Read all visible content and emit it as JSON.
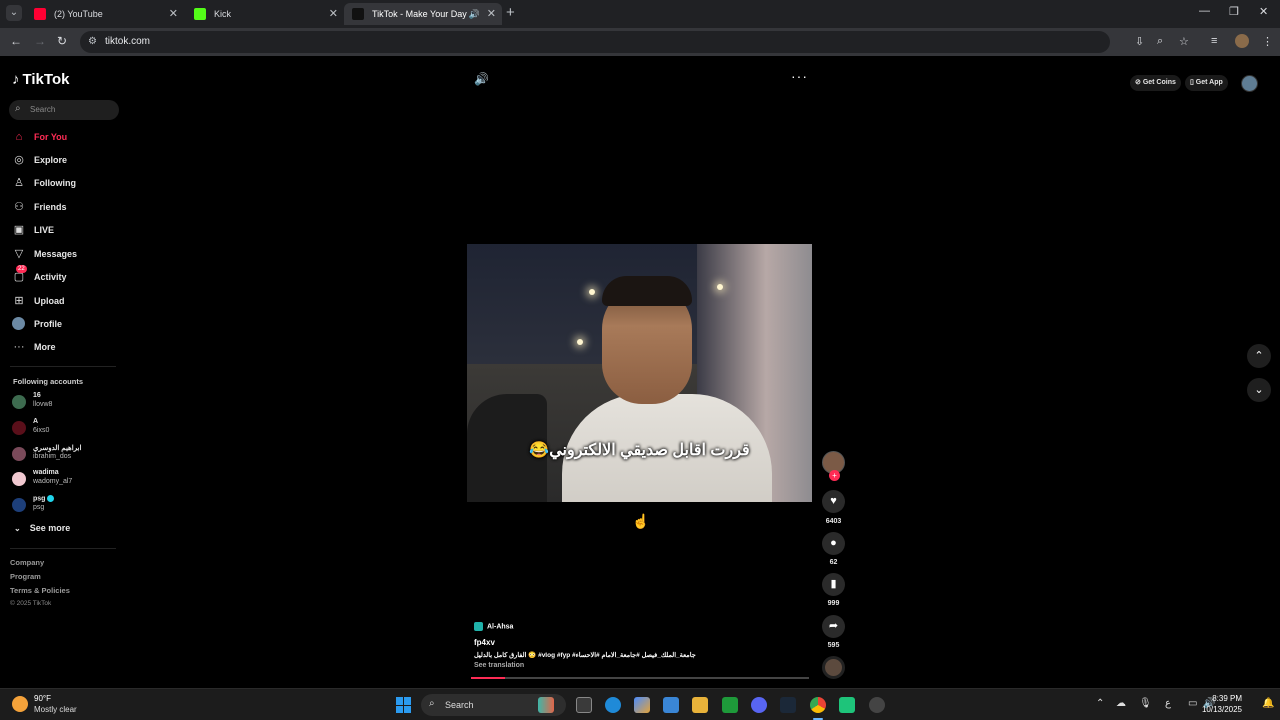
{
  "browser": {
    "tabs": [
      {
        "title": "(2) YouTube",
        "favicon_color": "#ff0033"
      },
      {
        "title": "Kick",
        "favicon_color": "#53fc18"
      },
      {
        "title": "TikTok - Make Your Day",
        "favicon_color": "#111111"
      }
    ],
    "url": "tiktok.com"
  },
  "tiktok": {
    "logo": "TikTok",
    "search_placeholder": "Search",
    "nav": [
      {
        "label": "For You",
        "icon": "home-icon"
      },
      {
        "label": "Explore",
        "icon": "compass-icon"
      },
      {
        "label": "Following",
        "icon": "user-plus-icon"
      },
      {
        "label": "Friends",
        "icon": "friends-icon"
      },
      {
        "label": "LIVE",
        "icon": "live-icon"
      },
      {
        "label": "Messages",
        "icon": "send-icon"
      },
      {
        "label": "Activity",
        "icon": "inbox-icon",
        "badge": "22"
      },
      {
        "label": "Upload",
        "icon": "upload-icon"
      },
      {
        "label": "Profile",
        "icon": "profile-avatar"
      },
      {
        "label": "More",
        "icon": "more-icon"
      }
    ],
    "following_title": "Following accounts",
    "accounts": [
      {
        "name": "16",
        "handle": "llovw8",
        "color": "#3d6b4f"
      },
      {
        "name": "A",
        "handle": "6ixs0",
        "color": "#5a0f1a"
      },
      {
        "name": "ابراهيم الدوسري",
        "handle": "ibrahim_dos",
        "color": "#7a4a5a"
      },
      {
        "name": "wadima",
        "handle": "wadomy_al7",
        "color": "#f0c8d0"
      },
      {
        "name": "psg",
        "handle": "psg",
        "color": "#1d3f7a"
      }
    ],
    "see_more": "See more",
    "footer": [
      "Company",
      "Program",
      "Terms & Policies"
    ],
    "copyright": "© 2025 TikTok",
    "get_coins": "Get Coins",
    "get_app": "Get App",
    "video": {
      "caption": "قررت اقابل صديقي الالكتروني😂",
      "location": "Al-Ahsa",
      "username": "fp4xv",
      "description": "الفارق كامل بالدليل 😳 #vlog #fyp #جامعة_الملك_فيصل #جامعة_الامام #الاحساء",
      "see_translation": "See translation",
      "progress_fraction": 0.1
    },
    "stats": {
      "likes": "6403",
      "comments": "62",
      "saves": "999",
      "shares": "595"
    }
  },
  "taskbar": {
    "temp": "90°F",
    "condition": "Mostly clear",
    "search": "Search",
    "time": "8:39 PM",
    "date": "10/13/2025"
  }
}
